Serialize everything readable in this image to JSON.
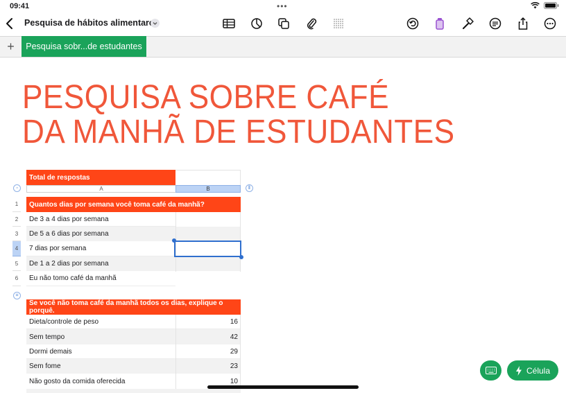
{
  "status": {
    "time": "09:41"
  },
  "toolbar": {
    "doc_title": "Pesquisa de hábitos alimentares"
  },
  "tabs": {
    "active_sheet": "Pesquisa sobr...de estudantes"
  },
  "page": {
    "title_line1": "PESQUISA SOBRE CAFÉ",
    "title_line2": "DA MANHÃ DE ESTUDANTES"
  },
  "table1": {
    "caption": "Total de respostas",
    "col_a": "A",
    "col_b": "B",
    "header": "Quantos dias por semana você toma café da manhã?",
    "row_numbers": [
      "1",
      "2",
      "3",
      "4",
      "5",
      "6"
    ],
    "rows": [
      "De 3 a 4 dias por semana",
      "De 5 a 6 dias por semana",
      "7 dias por semana",
      "De 1 a 2 dias por semana",
      "Eu não tomo café da manhã"
    ]
  },
  "table2": {
    "header": "Se você não toma café da manhã todos os dias, explique o porquê.",
    "rows": [
      {
        "label": "Dieta/controle de peso",
        "value": "16"
      },
      {
        "label": "Sem tempo",
        "value": "42"
      },
      {
        "label": "Dormi demais",
        "value": "29"
      },
      {
        "label": "Sem fome",
        "value": "23"
      },
      {
        "label": "Não gosto da comida oferecida",
        "value": "10"
      }
    ]
  },
  "bottom": {
    "cell_button": "Célula"
  },
  "colors": {
    "accent_green": "#1aa35a",
    "header_orange": "#ff4517",
    "title_orange": "#f0573a",
    "selection_blue": "#2f6fce"
  }
}
